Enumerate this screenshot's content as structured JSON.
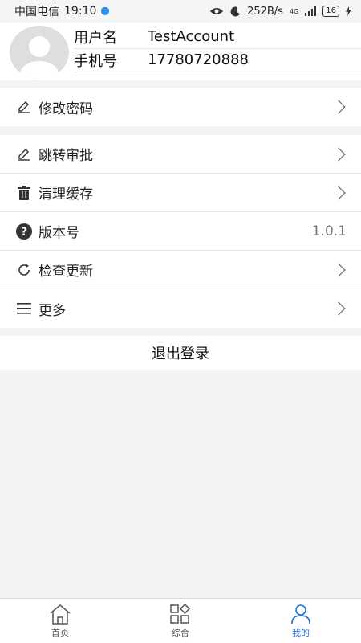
{
  "status_bar": {
    "carrier": "中国电信",
    "time": "19:10",
    "speed": "252B/s",
    "network": "4G",
    "battery": "16"
  },
  "profile": {
    "username_label": "用户名",
    "username": "TestAccount",
    "phone_label": "手机号",
    "phone": "17780720888"
  },
  "menu": {
    "change_password": "修改密码",
    "jump_approval": "跳转审批",
    "clear_cache": "清理缓存",
    "version_label": "版本号",
    "version_value": "1.0.1",
    "check_update": "检查更新",
    "more": "更多"
  },
  "logout_label": "退出登录",
  "tabs": [
    {
      "label": "首页",
      "icon": "home-icon"
    },
    {
      "label": "综合",
      "icon": "grid-icon"
    },
    {
      "label": "我的",
      "icon": "user-icon"
    }
  ],
  "colors": {
    "accent": "#1e6fd9",
    "background": "#f3f3f3"
  }
}
